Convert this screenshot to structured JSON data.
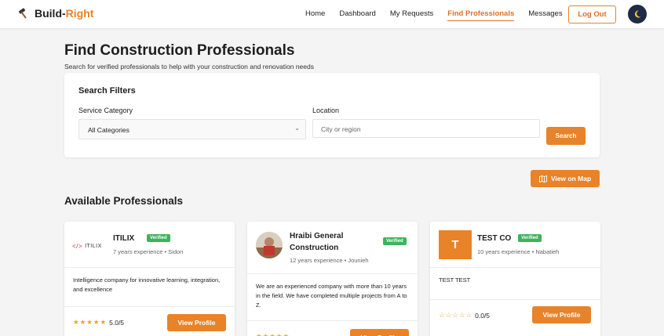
{
  "app": {
    "brand_main": "Build-",
    "brand_accent": "Right"
  },
  "nav": {
    "links": [
      "Home",
      "Dashboard",
      "My Requests",
      "Find Professionals",
      "Messages"
    ],
    "active": "Find Professionals",
    "logout_label": "Log Out"
  },
  "page": {
    "title": "Find Construction Professionals",
    "subtitle": "Search for verified professionals to help with your construction and renovation needs"
  },
  "filters": {
    "heading": "Search Filters",
    "category_label": "Service Category",
    "category_value": "All Categories",
    "location_label": "Location",
    "location_placeholder": "City or region",
    "search_label": "Search"
  },
  "map_button_label": "View on Map",
  "section_title": "Available Professionals",
  "professionals": [
    {
      "name": "ITILIX",
      "logo_text": "ITILIX",
      "badge": "Verified",
      "meta": "7 years experience • Sidon",
      "description": "Intelligence company for innovative learning, integration, and excellence",
      "rating_text": "5.0/5",
      "rating": 5,
      "button": "View Profile"
    },
    {
      "name": "Hraibi General Construction",
      "badge": "Verified",
      "meta": "12 years experience • Jounieh",
      "description": "We are an experienced company with more than 10 years in the field. We have completed multiple projects from A to Z.",
      "rating": 5,
      "button": "View Profile"
    },
    {
      "name": "TEST CO",
      "initial": "T",
      "badge": "Verified",
      "meta": "10 years experience • Nabatieh",
      "description": "TEST TEST",
      "rating_text": "0.0/5",
      "rating": 0,
      "button": "View Profile"
    }
  ],
  "colors": {
    "accent": "#e8832a",
    "verified": "#3cb35c",
    "theme_toggle": "#1f2a44"
  },
  "icons": [
    "hammer-icon",
    "moon-icon",
    "chevron-down-icon",
    "map-icon",
    "star-icon"
  ]
}
